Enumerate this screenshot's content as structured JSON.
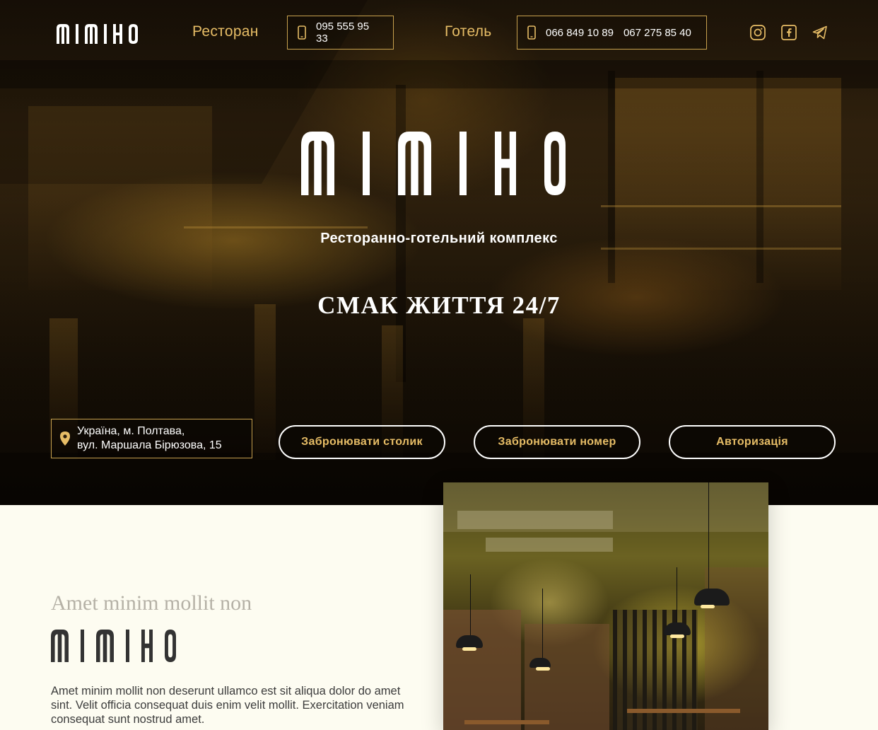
{
  "brand": {
    "name": "МІМІНО",
    "letters": [
      "m",
      "i",
      "m",
      "i",
      "h",
      "o"
    ],
    "gold": "#e7bd66",
    "border_gold": "#c9a24e"
  },
  "header": {
    "restaurant_label": "Ресторан",
    "restaurant_phone": "095 555 95 33",
    "hotel_label": "Готель",
    "hotel_phone_1": "066 849 10 89",
    "hotel_phone_2": "067 275 85 40",
    "social_icons": [
      "instagram-icon",
      "facebook-icon",
      "telegram-icon"
    ]
  },
  "hero": {
    "subtitle": "Ресторанно-готельний комплекс",
    "slogan": "СМАК ЖИТТЯ 24/7",
    "address_line_1": "Україна, м. Полтава,",
    "address_line_2": "вул. Маршала Бірюзова, 15",
    "buttons": {
      "book_table": "Забронювати столик",
      "book_room": "Забронювати номер",
      "login": "Авторизація"
    }
  },
  "about": {
    "kicker": "Amet minim mollit non",
    "text": "Amet minim mollit non deserunt ullamco est sit aliqua dolor do amet sint. Velit officia consequat duis enim velit mollit. Exercitation veniam consequat sunt nostrud amet."
  }
}
